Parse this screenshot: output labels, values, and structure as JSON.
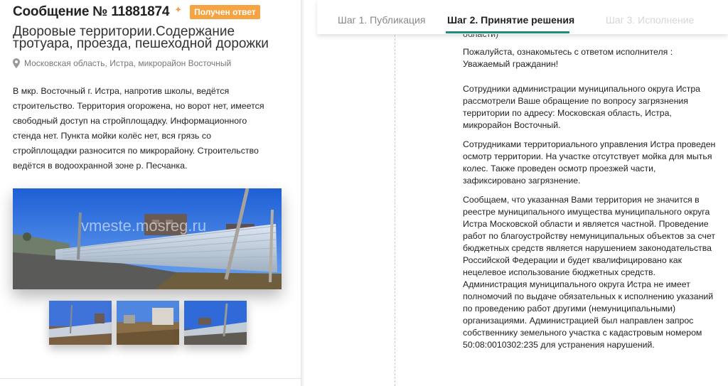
{
  "message": {
    "title": "Сообщение № 11881874",
    "badge": "Получен ответ",
    "category": "Дворовые территории.Содержание тротуара, проезда, пешеходной дорожки",
    "location": "Московская область, Истра, микрорайон Восточный",
    "description": "В мкр. Восточный г. Истра, напротив школы, ведётся строительство. Территория огорожена, но ворот нет, имеется свободный доступ на стройплощадку. Информационного стенда нет. Пункта мойки колёс нет, вся грязь со стройплощадки разносится по микрорайону. Строительство ведётся в водоохранной зоне р. Песчанка.",
    "watermark": "vmeste.mosreg.ru"
  },
  "tabs": [
    {
      "label": "Шаг 1. Публикация",
      "state": "done"
    },
    {
      "label": "Шаг 2. Принятие решения",
      "state": "active"
    },
    {
      "label": "Шаг 3. Исполнение",
      "state": "disabled"
    }
  ],
  "answer": {
    "cut_line": "области)",
    "intro": "Пожалуйста, ознакомьтесь с ответом исполнителя :",
    "greeting": "Уважаемый гражданин!",
    "paragraphs": [
      "Сотрудники администрации муниципального округа Истра рассмотрели Ваше обращение по вопросу загрязнения территории по адресу: Московская область, Истра, микрорайон Восточный.",
      "Сотрудниками территориального управления Истра проведен осмотр территории. На участке отсутствует мойка для мытья колес. Также проведен осмотр проезжей части, зафиксировано загрязнение.",
      "Сообщаем, что указанная Вами территория не значится в реестре муниципального имущества муниципального округа Истра Московской области и является частной. Проведение работ по благоустройству немуниципальных объектов за счет бюджетных средств является нарушением законодательства Российской Федерации и будет квалифицировано как нецелевое использование бюджетных средств. Администрация муниципального округа Истра не имеет полномочий по выдаче обязательных к исполнению указаний по проведению работ другими (немуниципальными) организациями. Администрацией был направлен запрос собственнику земельного участка с кадастровым номером 50:08:0010302:235 для устранения нарушений."
    ]
  },
  "colors": {
    "badge": "#f6a443",
    "accent": "#1e8a80",
    "text": "#222222"
  },
  "icons": [
    "pin-icon",
    "location-icon"
  ]
}
